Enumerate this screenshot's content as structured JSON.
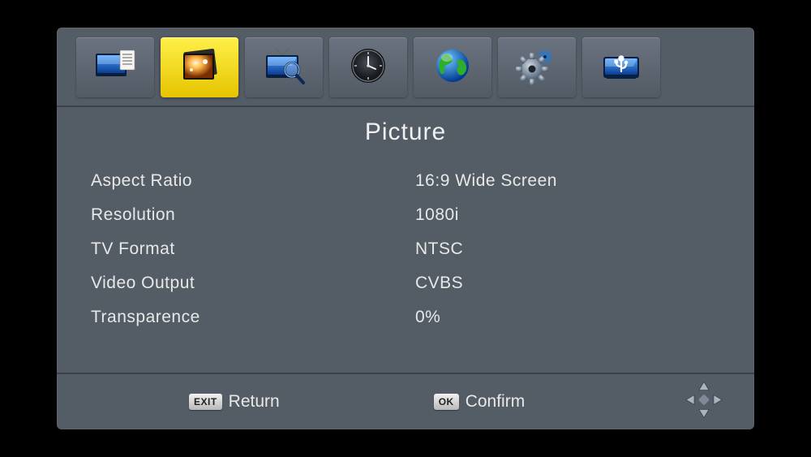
{
  "tabs": [
    {
      "name": "program",
      "selected": false
    },
    {
      "name": "picture",
      "selected": true
    },
    {
      "name": "search",
      "selected": false
    },
    {
      "name": "time",
      "selected": false
    },
    {
      "name": "language",
      "selected": false
    },
    {
      "name": "system",
      "selected": false
    },
    {
      "name": "usb",
      "selected": false
    }
  ],
  "title": "Picture",
  "settings": [
    {
      "label": "Aspect Ratio",
      "value": "16:9 Wide Screen"
    },
    {
      "label": "Resolution",
      "value": "1080i"
    },
    {
      "label": "TV Format",
      "value": "NTSC"
    },
    {
      "label": "Video Output",
      "value": "CVBS"
    },
    {
      "label": "Transparence",
      "value": "0%"
    }
  ],
  "footer": {
    "return_key": "EXIT",
    "return_label": "Return",
    "confirm_key": "OK",
    "confirm_label": "Confirm"
  }
}
